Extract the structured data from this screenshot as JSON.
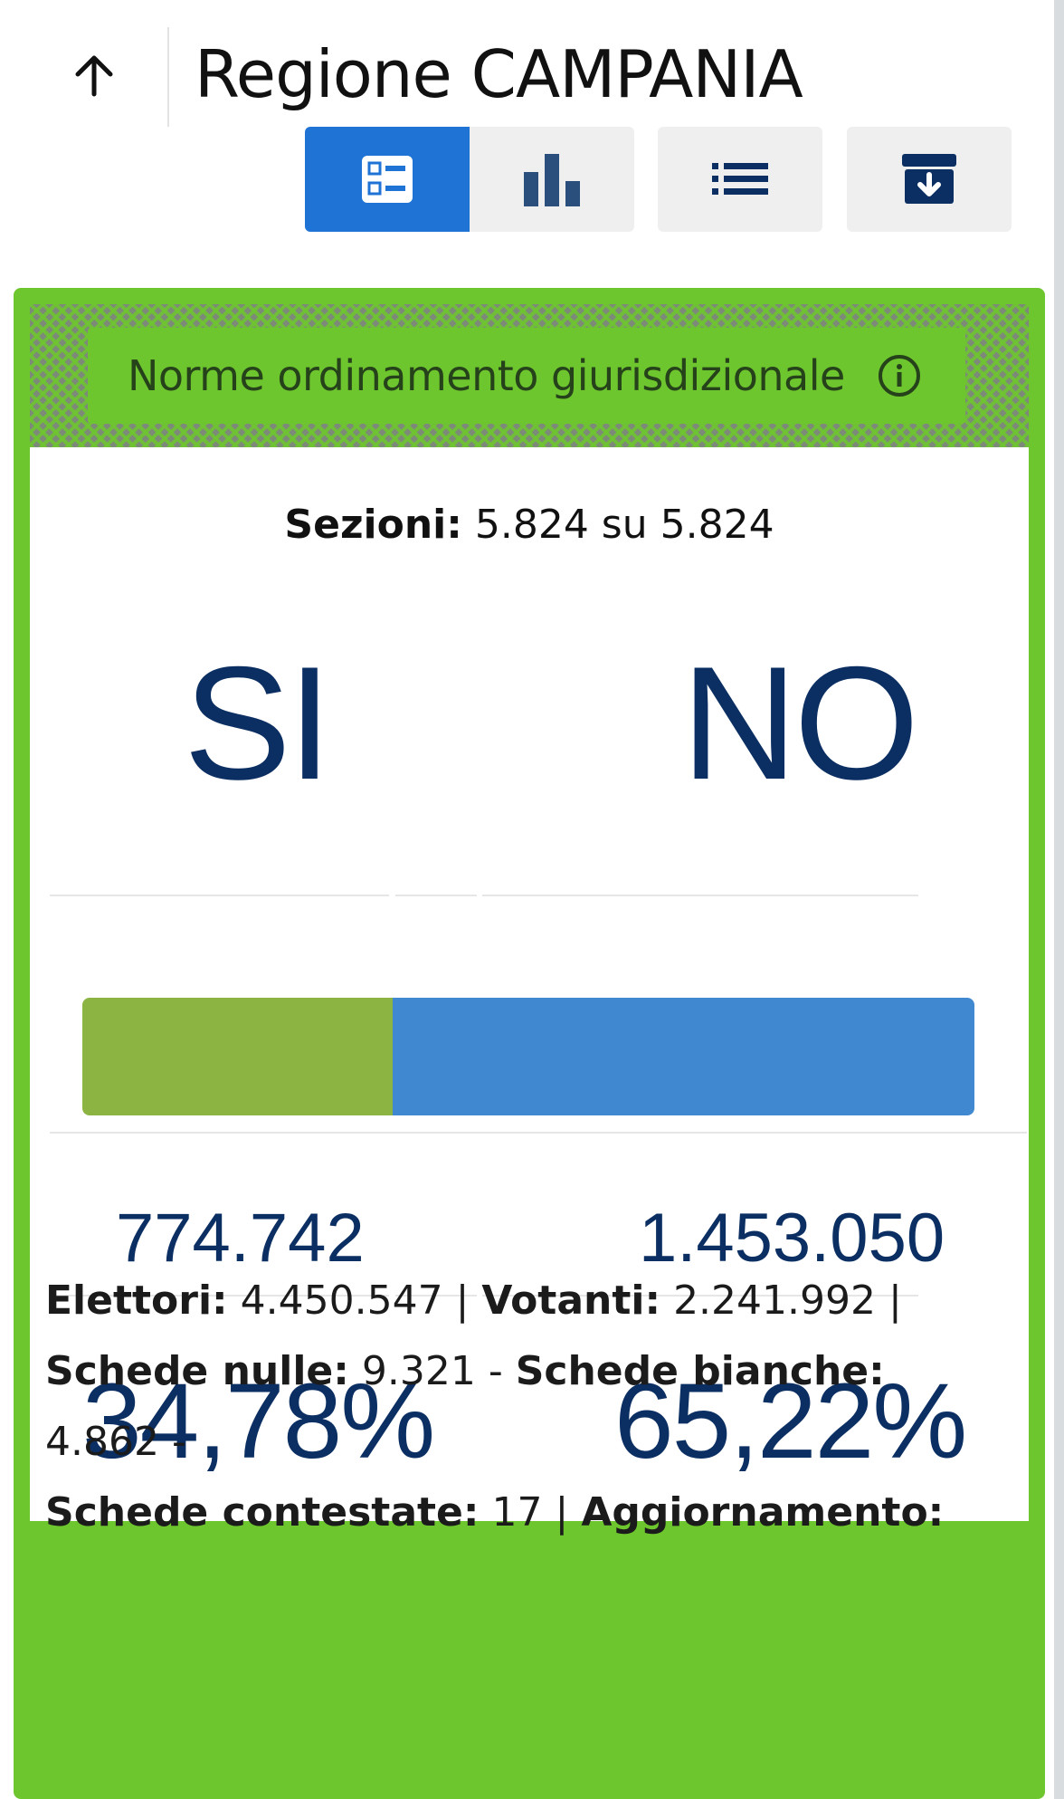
{
  "header": {
    "title": "Regione CAMPANIA",
    "back_icon": "arrow-up-icon",
    "view_buttons": [
      {
        "icon": "cards-icon",
        "active": true
      },
      {
        "icon": "bar-chart-icon",
        "active": false
      },
      {
        "icon": "list-icon",
        "active": false
      },
      {
        "icon": "archive-download-icon",
        "active": false
      }
    ]
  },
  "card": {
    "topic": "Norme ordinamento giurisdizionale",
    "sections_label": "Sezioni:",
    "sections_value": "5.824 su 5.824",
    "yes_label": "SI",
    "no_label": "NO",
    "yes_votes": "774.742",
    "no_votes": "1.453.050",
    "yes_pct": "34,78%",
    "no_pct": "65,22%",
    "yes_share": 0.3478,
    "colors": {
      "yes": "#8bb443",
      "no": "#4089d0",
      "card": "#6ec62e",
      "text": "#0b2f62"
    }
  },
  "footer": {
    "elettori_label": "Elettori:",
    "elettori_value": "4.450.547",
    "votanti_label": "Votanti:",
    "votanti_value": "2.241.992",
    "nulle_label": "Schede nulle:",
    "nulle_value": "9.321",
    "bianche_label": "Schede bianche:",
    "bianche_value": "4.862",
    "contestate_label": "Schede contestate:",
    "contestate_value": "17",
    "aggiornamento_label": "Aggiornamento:",
    "sep_pipe": "|",
    "sep_dash": "-"
  }
}
